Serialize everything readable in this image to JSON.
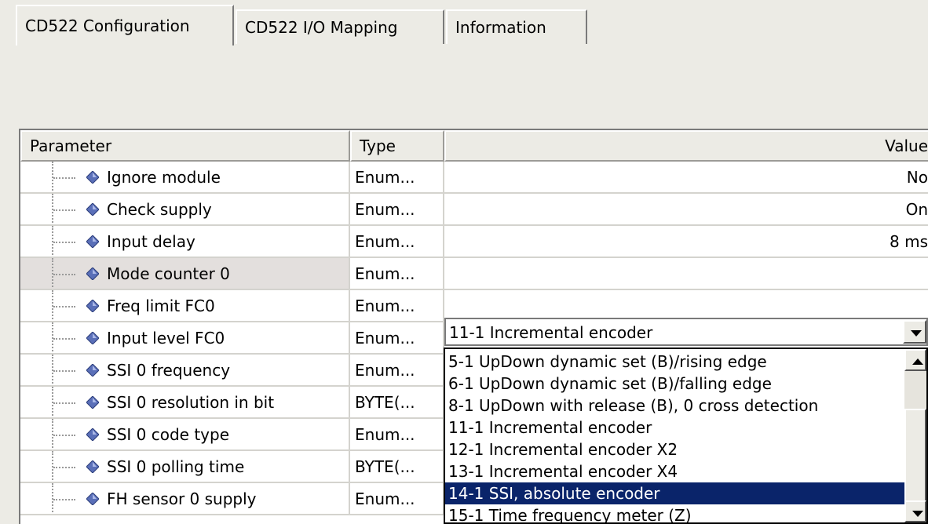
{
  "tabs": [
    {
      "label": "CD522 Configuration"
    },
    {
      "label": "CD522 I/O Mapping"
    },
    {
      "label": "Information"
    }
  ],
  "grid": {
    "columns": {
      "parameter": "Parameter",
      "type": "Type",
      "value": "Value"
    },
    "rows": [
      {
        "param": "Ignore module",
        "type": "Enum...",
        "value": "No"
      },
      {
        "param": "Check supply",
        "type": "Enum...",
        "value": "On"
      },
      {
        "param": "Input delay",
        "type": "Enum...",
        "value": "8 ms"
      },
      {
        "param": "Mode counter 0",
        "type": "Enum...",
        "value": ""
      },
      {
        "param": "Freq limit FC0",
        "type": "Enum...",
        "value": ""
      },
      {
        "param": "Input level FC0",
        "type": "Enum...",
        "value": ""
      },
      {
        "param": "SSI 0 frequency",
        "type": "Enum...",
        "value": ""
      },
      {
        "param": "SSI 0 resolution in bit",
        "type": "BYTE(...",
        "value": ""
      },
      {
        "param": "SSI 0 code type",
        "type": "Enum...",
        "value": ""
      },
      {
        "param": "SSI 0 polling time",
        "type": "BYTE(...",
        "value": ""
      },
      {
        "param": "FH sensor 0 supply",
        "type": "Enum...",
        "value": ""
      }
    ]
  },
  "combo": {
    "selected": "11-1 Incremental encoder",
    "options": [
      "5-1 UpDown dynamic set (B)/rising edge",
      "6-1 UpDown dynamic set (B)/falling edge",
      "8-1 UpDown with release (B), 0 cross detection",
      "11-1 Incremental encoder",
      "12-1 Incremental encoder X2",
      "13-1 Incremental encoder X4",
      "14-1 SSI, absolute encoder",
      "15-1 Time frequency meter (Z)"
    ],
    "highlighted_index": 6
  },
  "colors": {
    "highlight": "#0a246a",
    "panel": "#ecebe5"
  }
}
